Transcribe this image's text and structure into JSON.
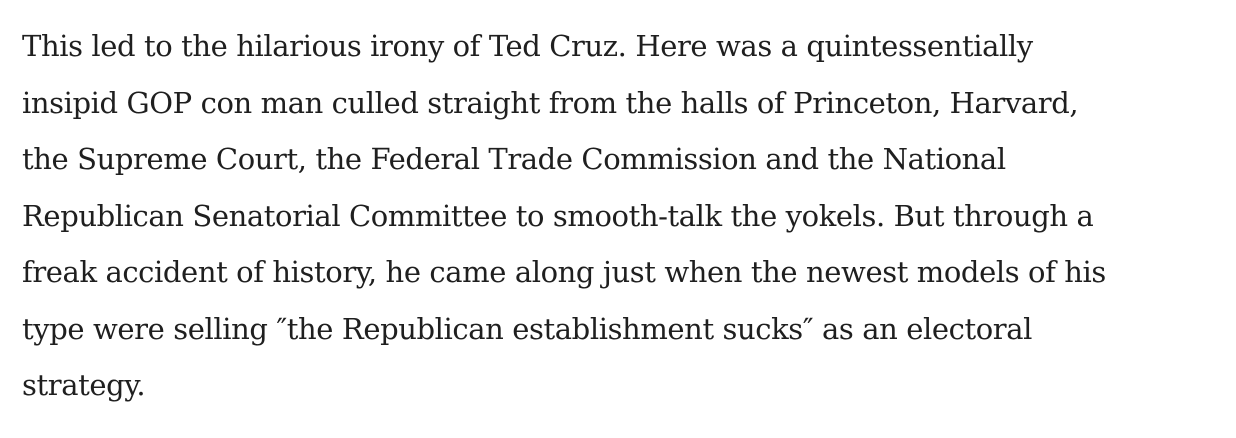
{
  "article": {
    "lines": [
      "This led to the hilarious irony of Ted Cruz. Here was a quintessentially",
      "insipid GOP con man culled straight from the halls of Princeton, Harvard,",
      "the Supreme Court, the Federal Trade Commission and the National",
      "Republican Senatorial Committee to smooth-talk the yokels. But through a",
      "freak accident of history, he came along just when the newest models of his",
      "type were selling ″the Republican establishment sucks″ as an electoral",
      "strategy."
    ]
  }
}
